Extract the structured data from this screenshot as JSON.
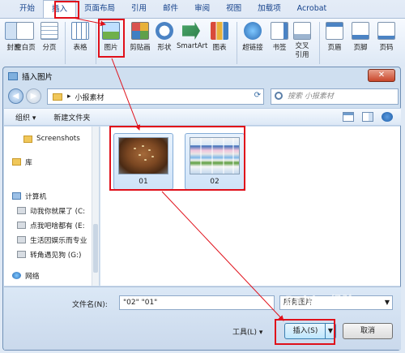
{
  "ribbon": {
    "tabs": [
      "开始",
      "插入",
      "页面布局",
      "引用",
      "邮件",
      "审阅",
      "视图",
      "加载项",
      "Acrobat"
    ],
    "buttons": [
      "封面",
      "空白页",
      "分页",
      "表格",
      "图片",
      "剪贴画",
      "形状",
      "SmartArt",
      "图表",
      "超链接",
      "书签",
      "交叉引用",
      "页眉",
      "页脚",
      "页码"
    ]
  },
  "dialog": {
    "title": "插入图片",
    "close_glyph": "✕",
    "address": "小报素材",
    "search_placeholder": "搜索 小报素材",
    "toolbar": {
      "organize": "组织 ▾",
      "new_folder": "新建文件夹"
    },
    "nav": [
      "Screenshots",
      "库",
      "计算机",
      "动我你就屎了 (C:",
      "点我吧啥都有 (E:",
      "生活因娱乐而专业",
      "转角遇见狗 (G:)",
      "网络"
    ],
    "files": [
      "01",
      "02"
    ],
    "filename_label": "文件名(N):",
    "filename_value": "\"02\" \"01\"",
    "filetype_value": "所有图片",
    "tools_label": "工具(L)  ▾",
    "insert_label": "插入(S)",
    "cancel_label": "取消"
  },
  "colors": {
    "highlight": "#e0101a",
    "accent": "#15428b"
  },
  "watermark": "Baidu 经验"
}
